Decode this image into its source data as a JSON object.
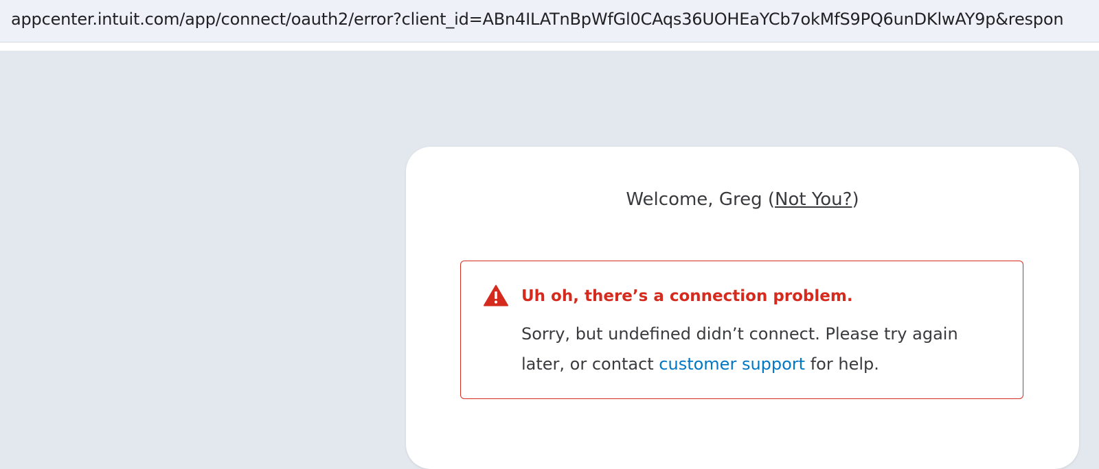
{
  "browser": {
    "url": "appcenter.intuit.com/app/connect/oauth2/error?client_id=ABn4ILATnBpWfGl0CAqs36UOHEaYCb7okMfS9PQ6unDKlwAY9p&respon"
  },
  "card": {
    "welcome_prefix": "Welcome, Greg (",
    "not_you_link": "Not You?",
    "welcome_suffix": ")",
    "error": {
      "icon": "warning-triangle-icon",
      "title": "Uh oh, there’s a connection problem.",
      "body_prefix": "Sorry, but undefined didn’t connect. Please try again later, or contact ",
      "support_link": "customer support",
      "body_suffix": " for help."
    }
  },
  "colors": {
    "error_red": "#d52b1e",
    "link_blue": "#0077c5",
    "page_bg": "#e3e8ee",
    "text": "#393a3d"
  }
}
